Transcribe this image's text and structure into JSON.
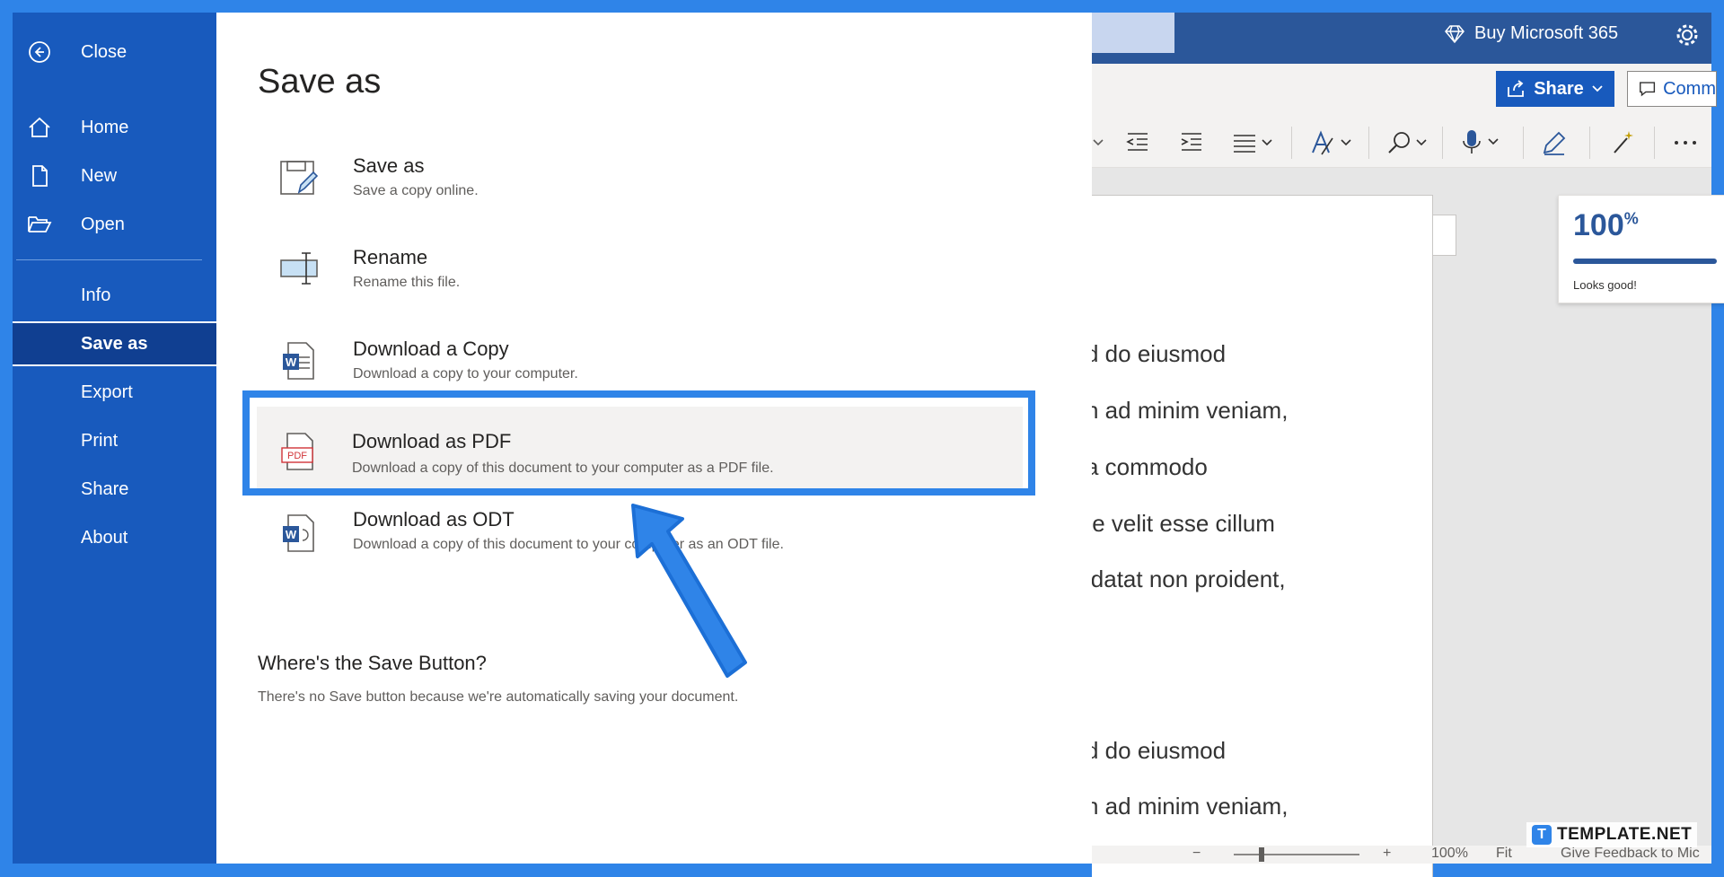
{
  "sidebar": {
    "items": [
      {
        "label": "Close",
        "icon": "back-arrow-icon"
      },
      {
        "label": "Home",
        "icon": "home-icon"
      },
      {
        "label": "New",
        "icon": "new-document-icon"
      },
      {
        "label": "Open",
        "icon": "folder-open-icon"
      },
      {
        "label": "Info"
      },
      {
        "label": "Save as",
        "active": true
      },
      {
        "label": "Export"
      },
      {
        "label": "Print"
      },
      {
        "label": "Share"
      },
      {
        "label": "About"
      }
    ]
  },
  "panel": {
    "title": "Save as",
    "options": [
      {
        "title": "Save as",
        "desc": "Save a copy online.",
        "icon": "save-as-icon"
      },
      {
        "title": "Rename",
        "desc": "Rename this file.",
        "icon": "rename-icon"
      },
      {
        "title": "Download a Copy",
        "desc": "Download a copy to your computer.",
        "icon": "word-document-icon"
      },
      {
        "title": "Download as PDF",
        "desc": "Download a copy of this document to your computer as a PDF file.",
        "icon": "pdf-icon",
        "highlighted": true
      },
      {
        "title": "Download as ODT",
        "desc": "Download a copy of this document to your computer as an ODT file.",
        "icon": "odt-document-icon"
      }
    ],
    "where_title": "Where's the Save Button?",
    "where_desc": "There's no Save button because we're automatically saving your document."
  },
  "app": {
    "buy_label": "Buy Microsoft 365",
    "share_label": "Share",
    "comments_label": "Comm",
    "doc_lines": [
      "d do eiusmod",
      "n ad minim veniam,",
      "a commodo",
      "te velit esse cillum",
      "idatat non proident,",
      ".",
      "d do eiusmod",
      "n ad minim veniam,"
    ],
    "editor": {
      "percent": "100",
      "percent_sign": "%",
      "status": "Looks good!",
      "score": 100
    },
    "status": {
      "zoom_minus": "−",
      "zoom_plus": "+",
      "zoom": "100%",
      "fit": "Fit",
      "feedback": "Give Feedback to Mic"
    }
  },
  "watermark": {
    "logo_letter": "T",
    "text": "TEMPLATE.NET"
  },
  "colors": {
    "frame": "#2f84e8",
    "sidebar": "#185abd",
    "sidebar_active": "#103f91",
    "highlight_border": "#2f84e8",
    "word_blue": "#2b579a"
  }
}
